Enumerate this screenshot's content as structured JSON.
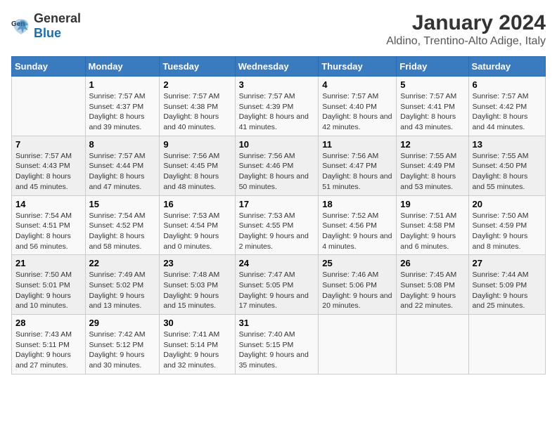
{
  "logo": {
    "general": "General",
    "blue": "Blue"
  },
  "title": "January 2024",
  "subtitle": "Aldino, Trentino-Alto Adige, Italy",
  "days_of_week": [
    "Sunday",
    "Monday",
    "Tuesday",
    "Wednesday",
    "Thursday",
    "Friday",
    "Saturday"
  ],
  "weeks": [
    [
      {
        "day": "",
        "info": ""
      },
      {
        "day": "1",
        "info": "Sunrise: 7:57 AM\nSunset: 4:37 PM\nDaylight: 8 hours and 39 minutes."
      },
      {
        "day": "2",
        "info": "Sunrise: 7:57 AM\nSunset: 4:38 PM\nDaylight: 8 hours and 40 minutes."
      },
      {
        "day": "3",
        "info": "Sunrise: 7:57 AM\nSunset: 4:39 PM\nDaylight: 8 hours and 41 minutes."
      },
      {
        "day": "4",
        "info": "Sunrise: 7:57 AM\nSunset: 4:40 PM\nDaylight: 8 hours and 42 minutes."
      },
      {
        "day": "5",
        "info": "Sunrise: 7:57 AM\nSunset: 4:41 PM\nDaylight: 8 hours and 43 minutes."
      },
      {
        "day": "6",
        "info": "Sunrise: 7:57 AM\nSunset: 4:42 PM\nDaylight: 8 hours and 44 minutes."
      }
    ],
    [
      {
        "day": "7",
        "info": "Sunrise: 7:57 AM\nSunset: 4:43 PM\nDaylight: 8 hours and 45 minutes."
      },
      {
        "day": "8",
        "info": "Sunrise: 7:57 AM\nSunset: 4:44 PM\nDaylight: 8 hours and 47 minutes."
      },
      {
        "day": "9",
        "info": "Sunrise: 7:56 AM\nSunset: 4:45 PM\nDaylight: 8 hours and 48 minutes."
      },
      {
        "day": "10",
        "info": "Sunrise: 7:56 AM\nSunset: 4:46 PM\nDaylight: 8 hours and 50 minutes."
      },
      {
        "day": "11",
        "info": "Sunrise: 7:56 AM\nSunset: 4:47 PM\nDaylight: 8 hours and 51 minutes."
      },
      {
        "day": "12",
        "info": "Sunrise: 7:55 AM\nSunset: 4:49 PM\nDaylight: 8 hours and 53 minutes."
      },
      {
        "day": "13",
        "info": "Sunrise: 7:55 AM\nSunset: 4:50 PM\nDaylight: 8 hours and 55 minutes."
      }
    ],
    [
      {
        "day": "14",
        "info": "Sunrise: 7:54 AM\nSunset: 4:51 PM\nDaylight: 8 hours and 56 minutes."
      },
      {
        "day": "15",
        "info": "Sunrise: 7:54 AM\nSunset: 4:52 PM\nDaylight: 8 hours and 58 minutes."
      },
      {
        "day": "16",
        "info": "Sunrise: 7:53 AM\nSunset: 4:54 PM\nDaylight: 9 hours and 0 minutes."
      },
      {
        "day": "17",
        "info": "Sunrise: 7:53 AM\nSunset: 4:55 PM\nDaylight: 9 hours and 2 minutes."
      },
      {
        "day": "18",
        "info": "Sunrise: 7:52 AM\nSunset: 4:56 PM\nDaylight: 9 hours and 4 minutes."
      },
      {
        "day": "19",
        "info": "Sunrise: 7:51 AM\nSunset: 4:58 PM\nDaylight: 9 hours and 6 minutes."
      },
      {
        "day": "20",
        "info": "Sunrise: 7:50 AM\nSunset: 4:59 PM\nDaylight: 9 hours and 8 minutes."
      }
    ],
    [
      {
        "day": "21",
        "info": "Sunrise: 7:50 AM\nSunset: 5:01 PM\nDaylight: 9 hours and 10 minutes."
      },
      {
        "day": "22",
        "info": "Sunrise: 7:49 AM\nSunset: 5:02 PM\nDaylight: 9 hours and 13 minutes."
      },
      {
        "day": "23",
        "info": "Sunrise: 7:48 AM\nSunset: 5:03 PM\nDaylight: 9 hours and 15 minutes."
      },
      {
        "day": "24",
        "info": "Sunrise: 7:47 AM\nSunset: 5:05 PM\nDaylight: 9 hours and 17 minutes."
      },
      {
        "day": "25",
        "info": "Sunrise: 7:46 AM\nSunset: 5:06 PM\nDaylight: 9 hours and 20 minutes."
      },
      {
        "day": "26",
        "info": "Sunrise: 7:45 AM\nSunset: 5:08 PM\nDaylight: 9 hours and 22 minutes."
      },
      {
        "day": "27",
        "info": "Sunrise: 7:44 AM\nSunset: 5:09 PM\nDaylight: 9 hours and 25 minutes."
      }
    ],
    [
      {
        "day": "28",
        "info": "Sunrise: 7:43 AM\nSunset: 5:11 PM\nDaylight: 9 hours and 27 minutes."
      },
      {
        "day": "29",
        "info": "Sunrise: 7:42 AM\nSunset: 5:12 PM\nDaylight: 9 hours and 30 minutes."
      },
      {
        "day": "30",
        "info": "Sunrise: 7:41 AM\nSunset: 5:14 PM\nDaylight: 9 hours and 32 minutes."
      },
      {
        "day": "31",
        "info": "Sunrise: 7:40 AM\nSunset: 5:15 PM\nDaylight: 9 hours and 35 minutes."
      },
      {
        "day": "",
        "info": ""
      },
      {
        "day": "",
        "info": ""
      },
      {
        "day": "",
        "info": ""
      }
    ]
  ]
}
